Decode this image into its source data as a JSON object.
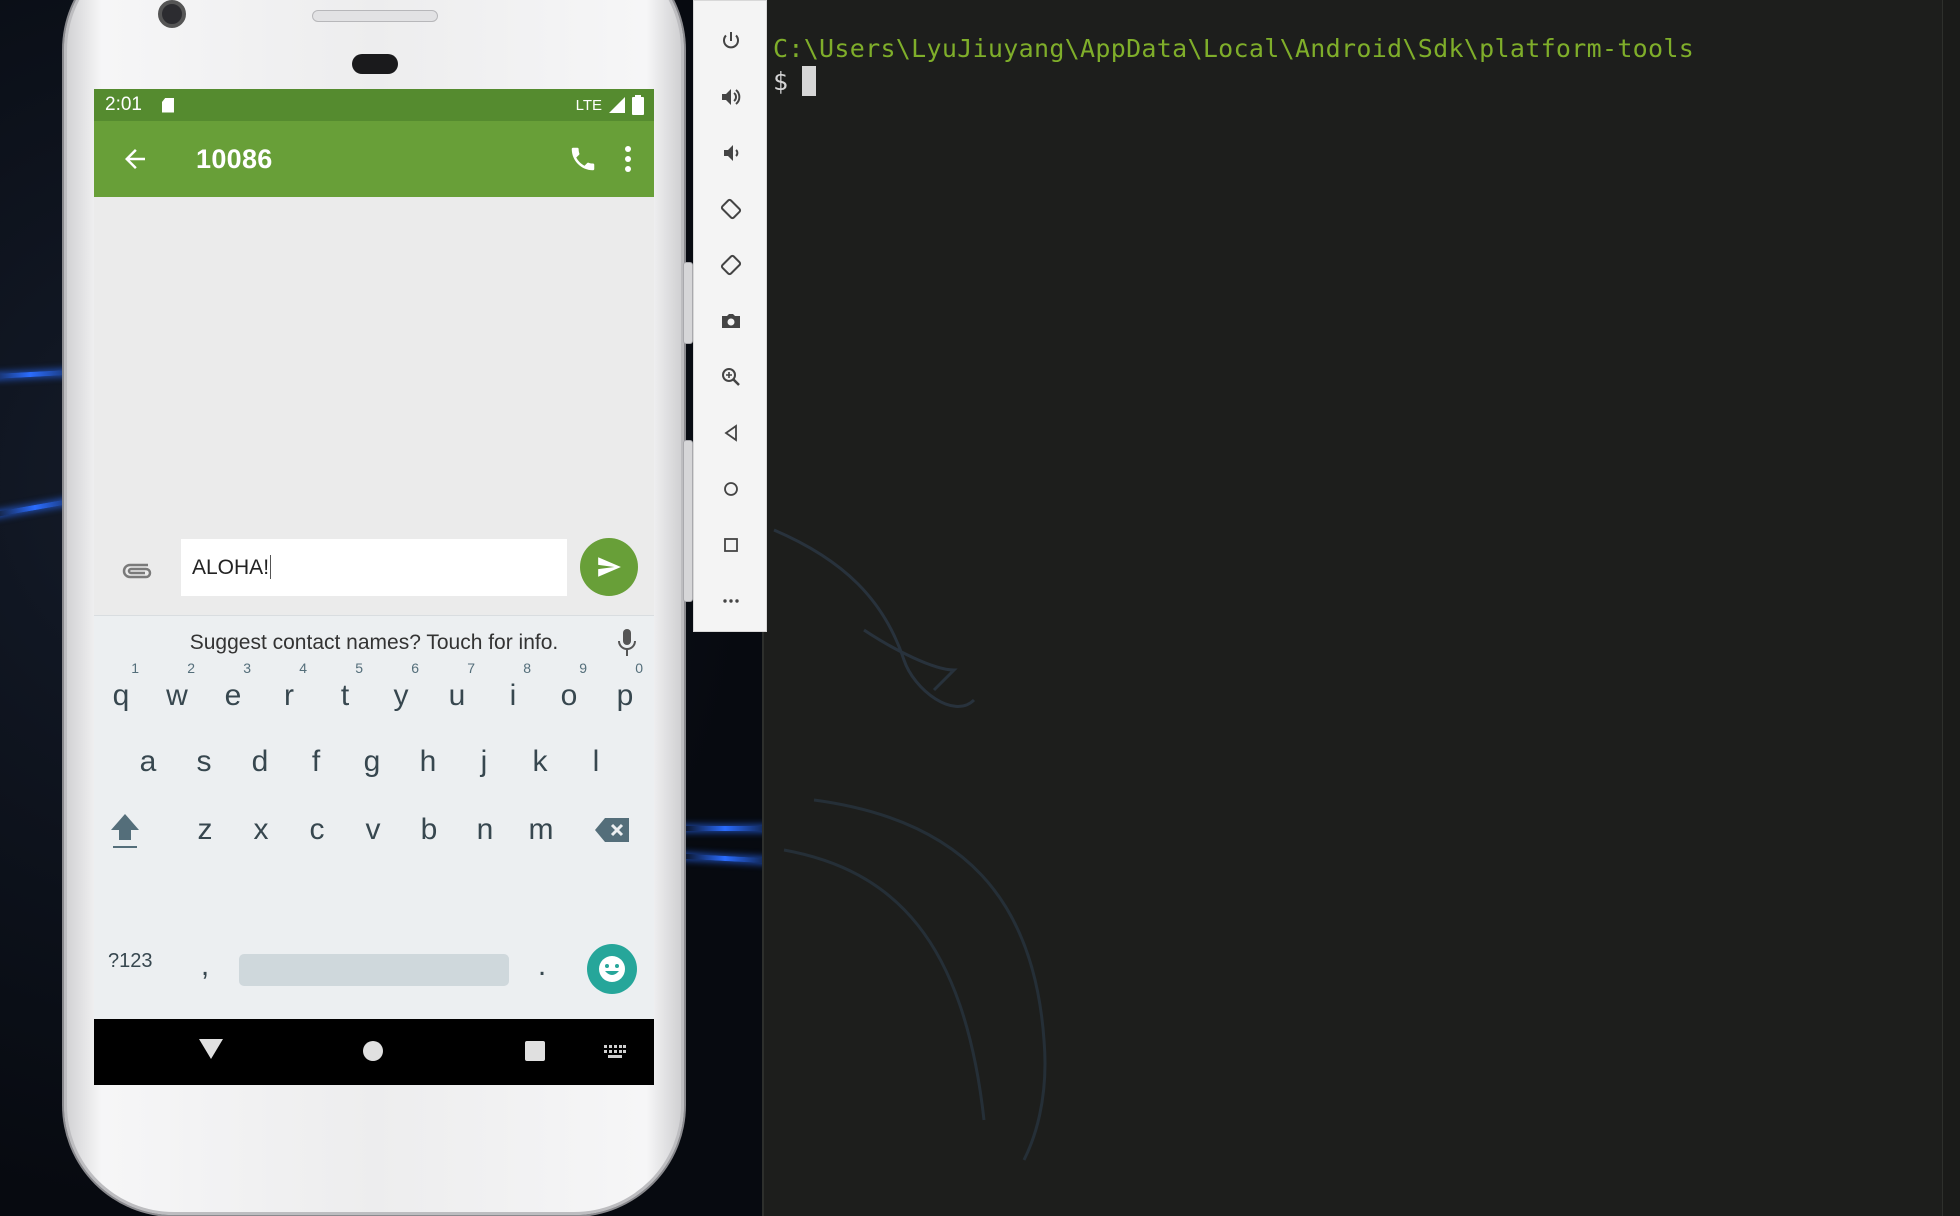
{
  "terminal": {
    "path_line": "C:\\Users\\LyuJiuyang\\AppData\\Local\\Android\\Sdk\\platform-tools",
    "prompt": "$"
  },
  "emulator_toolbar": {
    "tools": [
      "power-icon",
      "volume-up-icon",
      "volume-down-icon",
      "rotate-left-icon",
      "rotate-right-icon",
      "camera-icon",
      "zoom-icon",
      "back-icon",
      "home-icon",
      "overview-icon",
      "more-icon"
    ]
  },
  "phone": {
    "status_bar": {
      "time": "2:01",
      "network": "LTE"
    },
    "app_bar": {
      "title": "10086"
    },
    "compose": {
      "message": "ALOHA!"
    },
    "keyboard": {
      "suggestion": "Suggest contact names? Touch for info.",
      "row1": [
        {
          "key": "q",
          "hint": "1"
        },
        {
          "key": "w",
          "hint": "2"
        },
        {
          "key": "e",
          "hint": "3"
        },
        {
          "key": "r",
          "hint": "4"
        },
        {
          "key": "t",
          "hint": "5"
        },
        {
          "key": "y",
          "hint": "6"
        },
        {
          "key": "u",
          "hint": "7"
        },
        {
          "key": "i",
          "hint": "8"
        },
        {
          "key": "o",
          "hint": "9"
        },
        {
          "key": "p",
          "hint": "0"
        }
      ],
      "row2": [
        "a",
        "s",
        "d",
        "f",
        "g",
        "h",
        "j",
        "k",
        "l"
      ],
      "row3": [
        "z",
        "x",
        "c",
        "v",
        "b",
        "n",
        "m"
      ],
      "symbols_label": "?123",
      "comma": ",",
      "period": "."
    },
    "colors": {
      "app_bar": "#689f38",
      "status_bar": "#558b2f",
      "emoji": "#26a69a"
    }
  }
}
